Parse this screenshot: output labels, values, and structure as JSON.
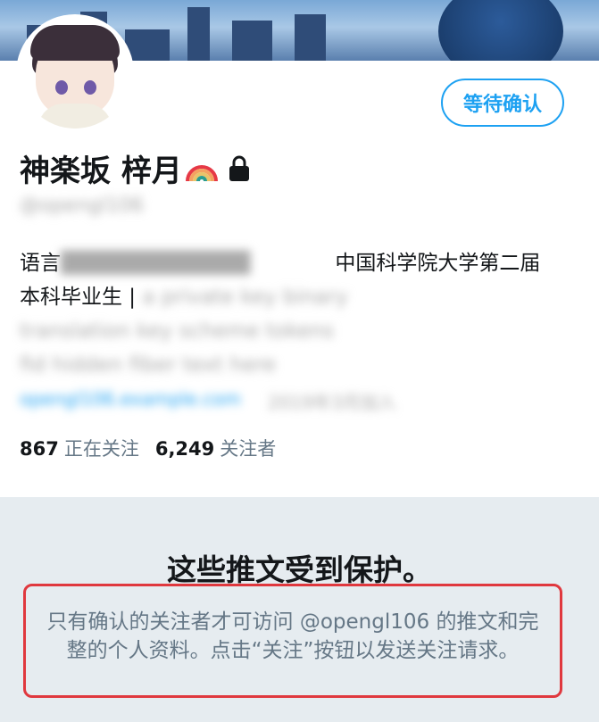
{
  "profile": {
    "display_name": "神楽坂 梓月",
    "handle": "@opengl106",
    "pending_button": "等待确认",
    "bio_line1_prefix": "语言",
    "bio_line1_suffix": "中国科学院大学第二届",
    "bio_line2_prefix": "本科毕业生 |",
    "bio_line2_blur": "a private key binary",
    "bio_line3": "translation key scheme tokens",
    "bio_line4": "fid hidden fiber text here",
    "link_text": "opengl106.example.com",
    "joined": "2019年3月加入"
  },
  "stats": {
    "following_count": "867",
    "following_label": "正在关注",
    "followers_count": "6,249",
    "followers_label": "关注者"
  },
  "protected": {
    "title": "这些推文受到保护。",
    "message": "只有确认的关注者才可访问 @opengl106 的推文和完整的个人资料。点击“关注”按钮以发送关注请求。"
  },
  "colors": {
    "accent": "#1da1f2",
    "highlight_border": "#e0383e",
    "panel_bg": "#e6ecf0"
  }
}
